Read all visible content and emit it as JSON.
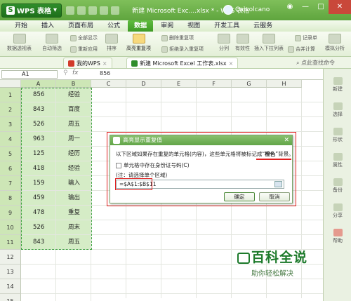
{
  "window": {
    "app_button": "WPS 表格",
    "doc_title": "新建 Microsoft Exc....xlsx * - WPS 表格",
    "user": "Caivolcano"
  },
  "menu": {
    "tabs": [
      "开始",
      "插入",
      "页面布局",
      "公式",
      "数据",
      "审阅",
      "视图",
      "开发工具",
      "云服务"
    ],
    "active": "数据"
  },
  "ribbon": {
    "pivot": "数据透视表",
    "autofilter": "自动筛选",
    "show_all": "全部显示",
    "reapply": "重新应用",
    "sort_asc": "",
    "sort": "排序",
    "highlight_dup": "高亮重复项",
    "remove_dup": "删除重复项",
    "reject_dup": "拒绝录入重复项",
    "split": "分列",
    "validity": "有效性",
    "insert_dropdown": "插入下拉列表",
    "records": "记录单",
    "merge_calc": "合并计算",
    "simulate": "模拟分析"
  },
  "doctabs": {
    "mywps": "我的WPS",
    "file": "新建 Microsoft Excel 工作表.xlsx",
    "search_placeholder": "点此查找命令"
  },
  "formula_bar": {
    "name_box": "A1",
    "fx": "fx",
    "value": "856"
  },
  "sheet": {
    "columns": [
      "A",
      "B",
      "C",
      "D",
      "E",
      "F",
      "G",
      "H"
    ],
    "rows": [
      {
        "n": "1",
        "a": "856",
        "b": "经验"
      },
      {
        "n": "2",
        "a": "843",
        "b": "百度"
      },
      {
        "n": "3",
        "a": "526",
        "b": "周五"
      },
      {
        "n": "4",
        "a": "963",
        "b": "周一"
      },
      {
        "n": "5",
        "a": "125",
        "b": "经历"
      },
      {
        "n": "6",
        "a": "418",
        "b": "经验"
      },
      {
        "n": "7",
        "a": "159",
        "b": "输入"
      },
      {
        "n": "8",
        "a": "459",
        "b": "输出"
      },
      {
        "n": "9",
        "a": "478",
        "b": "重复"
      },
      {
        "n": "10",
        "a": "526",
        "b": "周末"
      },
      {
        "n": "11",
        "a": "843",
        "b": "周五"
      },
      {
        "n": "12",
        "a": "",
        "b": ""
      },
      {
        "n": "13",
        "a": "",
        "b": ""
      },
      {
        "n": "14",
        "a": "",
        "b": ""
      },
      {
        "n": "15",
        "a": "",
        "b": ""
      }
    ]
  },
  "side_panel": [
    "新建",
    "选择",
    "形状",
    "属性",
    "备份",
    "分享",
    "帮助"
  ],
  "dialog": {
    "title": "高亮显示重复值",
    "desc_prefix": "以下区域如果存在重复的单元格(内容)，这些单元格将被标记成“",
    "desc_color": "橙色",
    "desc_suffix": "”背景。",
    "checkbox_label": "单元格中存在身份证号码(C)",
    "note": "(注：请选择单个区域)",
    "range": "=$A$1:$B$11",
    "ok": "确定",
    "cancel": "取消"
  },
  "watermark": {
    "title": "百科全说",
    "subtitle": "助你轻松解决"
  }
}
